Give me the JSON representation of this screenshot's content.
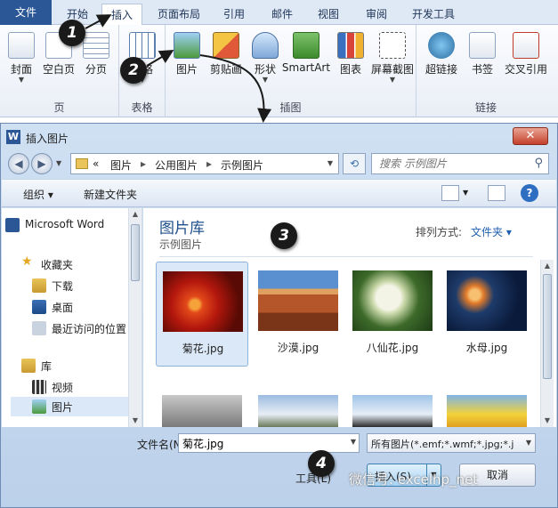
{
  "ribbon": {
    "tabs": [
      "文件",
      "开始",
      "插入",
      "页面布局",
      "引用",
      "邮件",
      "视图",
      "审阅",
      "开发工具"
    ],
    "active_tab": "插入",
    "groups": {
      "pages": {
        "label": "页",
        "buttons": [
          "封面",
          "空白页",
          "分页"
        ]
      },
      "tables": {
        "label": "表格",
        "buttons": [
          "表格"
        ]
      },
      "illustrations": {
        "label": "插图",
        "buttons": [
          "图片",
          "剪贴画",
          "形状",
          "SmartArt",
          "图表",
          "屏幕截图"
        ]
      },
      "links": {
        "label": "链接",
        "buttons": [
          "超链接",
          "书签",
          "交叉引用"
        ]
      }
    }
  },
  "steps": [
    "1",
    "2",
    "3",
    "4"
  ],
  "dialog": {
    "title": "插入图片",
    "app_letter": "W",
    "close_symbol": "✕",
    "address": {
      "prefix": "«",
      "crumbs": [
        "图片",
        "公用图片",
        "示例图片"
      ],
      "sep": "▸"
    },
    "search_placeholder": "搜索 示例图片",
    "toolbar": {
      "organize": "组织 ▾",
      "new_folder": "新建文件夹",
      "help": "?"
    },
    "nav": {
      "items": [
        "Microsoft Word",
        "收藏夹",
        "下载",
        "桌面",
        "最近访问的位置",
        "库",
        "视频",
        "图片"
      ],
      "selected": "图片"
    },
    "library": {
      "title": "图片库",
      "subtitle": "示例图片",
      "sort_label": "排列方式:",
      "sort_value": "文件夹 ▾"
    },
    "files": [
      {
        "name": "菊花.jpg",
        "selected": true
      },
      {
        "name": "沙漠.jpg",
        "selected": false
      },
      {
        "name": "八仙花.jpg",
        "selected": false
      },
      {
        "name": "水母.jpg",
        "selected": false
      },
      {
        "name": "",
        "selected": false
      },
      {
        "name": "",
        "selected": false
      },
      {
        "name": "",
        "selected": false
      },
      {
        "name": "",
        "selected": false
      }
    ],
    "filename_label": "文件名(N):",
    "filename_value": "菊花.jpg",
    "filetype_value": "所有图片(*.emf;*.wmf;*.jpg;*.j",
    "tools_label": "工具(L)",
    "insert_label": "插入(S)",
    "cancel_label": "取消"
  },
  "watermark": "微信号: excelhp_net",
  "colors": {
    "file_tab": "#2b5797",
    "dialog_frame": "#bcd1ea",
    "selection": "#dbe8f8",
    "marker": "#1a1a1a"
  }
}
